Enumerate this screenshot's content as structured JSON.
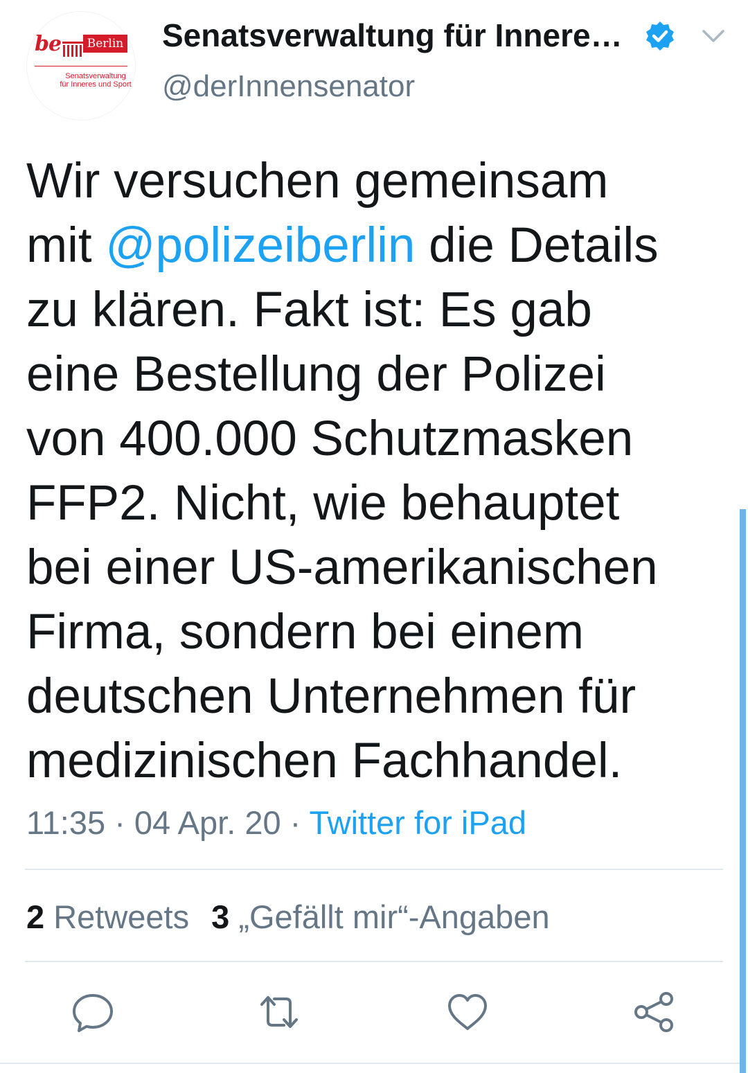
{
  "author": {
    "display_name": "Senatsverwaltung für Innere…",
    "handle": "@derInnensenator",
    "verified": true,
    "avatar": {
      "logo_prefix": "be",
      "logo_city": "Berlin",
      "logo_subtitle_line1": "Senatsverwaltung",
      "logo_subtitle_line2": "für Inneres und Sport",
      "brand_color": "#d41c2b"
    }
  },
  "tweet": {
    "lines": [
      {
        "pre": "Wir versuchen gemeinsam",
        "mention": "",
        "post": ""
      },
      {
        "pre": "mit ",
        "mention": "@polizeiberlin",
        "post": " die Details"
      },
      {
        "pre": "zu klären. Fakt ist: Es gab",
        "mention": "",
        "post": ""
      },
      {
        "pre": "eine Bestellung der Polizei",
        "mention": "",
        "post": ""
      },
      {
        "pre": "von 400.000 Schutzmasken",
        "mention": "",
        "post": ""
      },
      {
        "pre": "FFP2. Nicht, wie behauptet",
        "mention": "",
        "post": ""
      },
      {
        "pre": "bei einer US-amerikanischen",
        "mention": "",
        "post": ""
      },
      {
        "pre": "Firma, sondern bei einem",
        "mention": "",
        "post": ""
      },
      {
        "pre": "deutschen Unternehmen für",
        "mention": "",
        "post": ""
      },
      {
        "pre": "medizinischen Fachhandel.",
        "mention": "",
        "post": ""
      }
    ],
    "time": "11:35",
    "date": "04 Apr. 20",
    "separator": " · ",
    "source": "Twitter for iPad"
  },
  "stats": {
    "retweets_count": "2",
    "retweets_label": " Retweets",
    "likes_count": "3",
    "likes_label": " „Gefällt mir“-Angaben"
  },
  "actions": [
    {
      "name": "reply-icon"
    },
    {
      "name": "retweet-icon"
    },
    {
      "name": "like-icon"
    },
    {
      "name": "share-icon"
    }
  ],
  "colors": {
    "text": "#14171a",
    "secondary": "#657786",
    "link": "#1da1f2",
    "divider": "#e1e8ed",
    "scrollbar": "#6fb4e6"
  }
}
